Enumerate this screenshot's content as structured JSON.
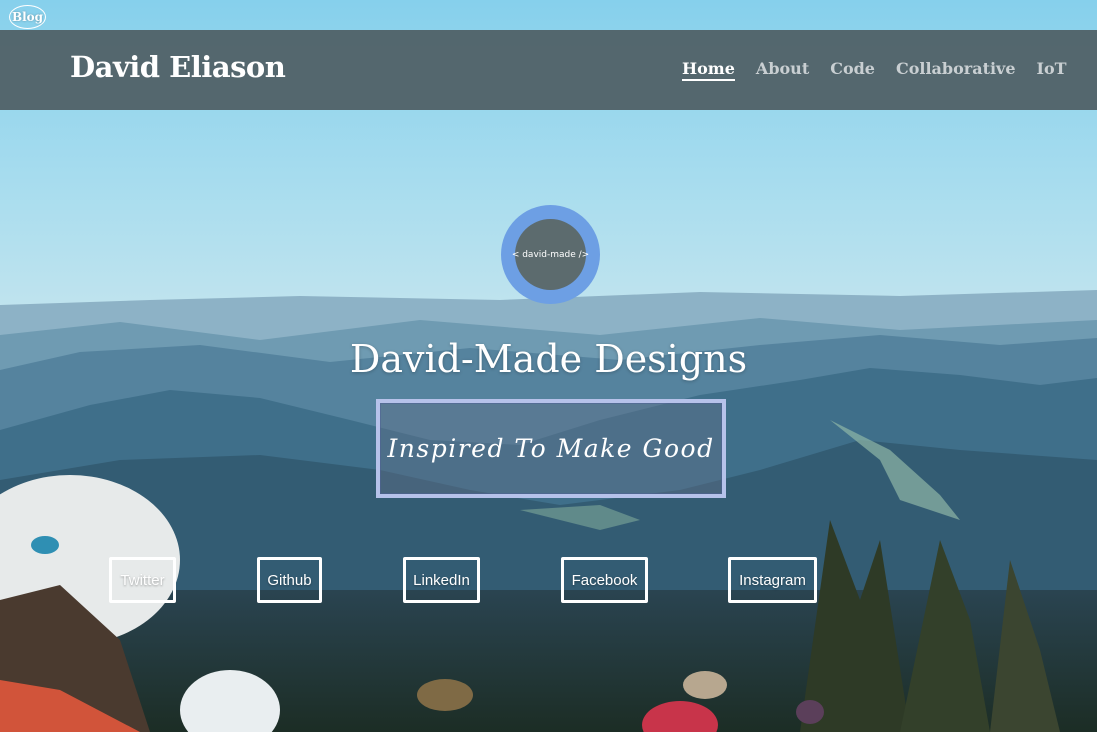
{
  "blog_badge": "Blog",
  "brand": "David Eliason",
  "nav": [
    "Home",
    "About",
    "Code",
    "Collaborative",
    "IoT"
  ],
  "nav_active": "Home",
  "logo_text": "< david-made />",
  "hero_title": "David-Made Designs",
  "tagline": "Inspired To Make Good",
  "social": [
    "Twitter",
    "Github",
    "LinkedIn",
    "Facebook",
    "Instagram"
  ],
  "colors": {
    "navbar": "#526369",
    "logo_ring": "#6d9fe4",
    "logo_inner": "#5c6b6e",
    "tagline_border": "#b6c2ea"
  }
}
